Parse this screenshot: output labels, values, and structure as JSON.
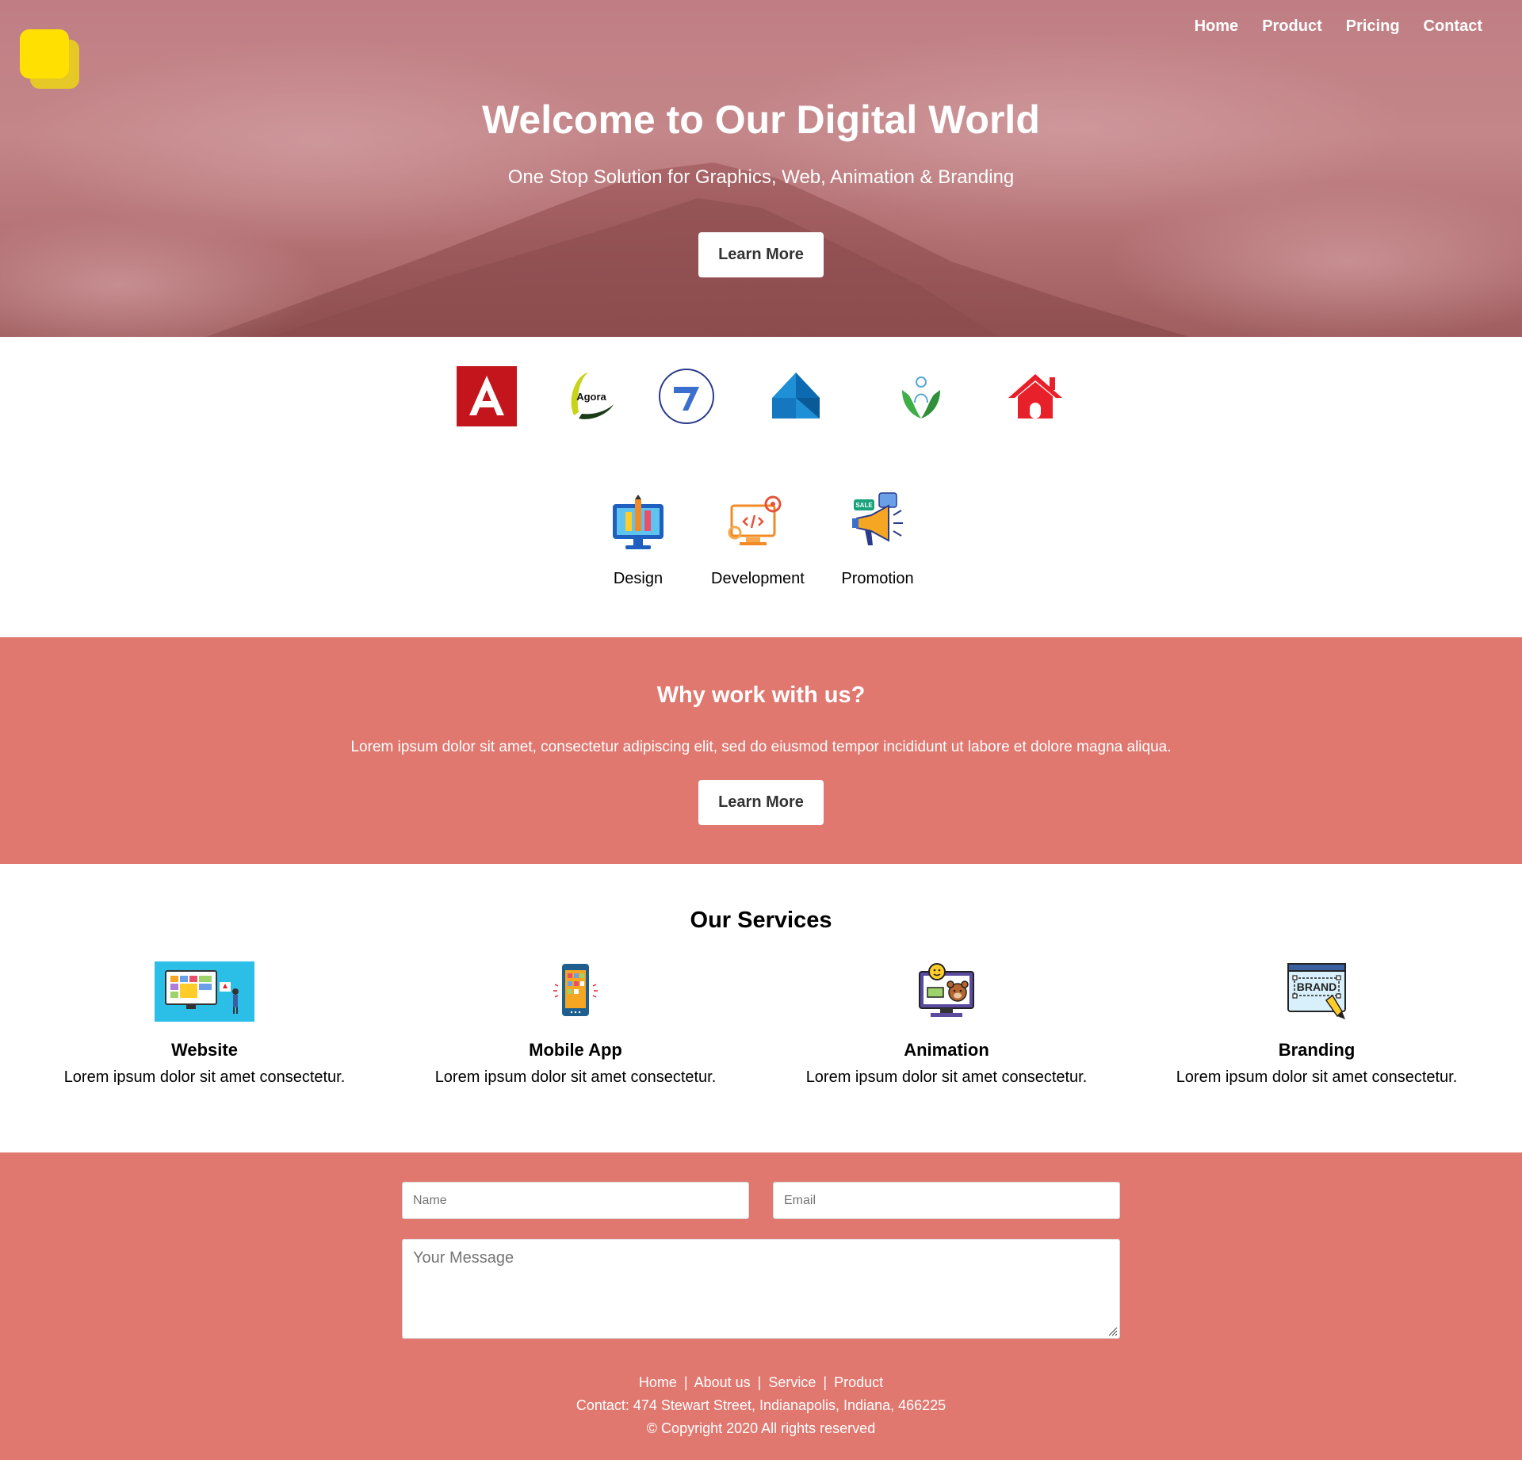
{
  "nav": {
    "items": [
      "Home",
      "Product",
      "Pricing",
      "Contact"
    ]
  },
  "hero": {
    "title": "Welcome to Our Digital World",
    "subtitle": "One Stop Solution for Graphics, Web, Animation & Branding",
    "button": "Learn More"
  },
  "clients": {
    "agora_text": "Agora",
    "logos": [
      "angular-logo",
      "agora-logo",
      "stroke-logo",
      "blue-house-logo",
      "hands-person-logo",
      "red-house-logo"
    ]
  },
  "features": [
    {
      "label": "Design",
      "icon": "design-monitor-icon"
    },
    {
      "label": "Development",
      "icon": "development-monitor-icon"
    },
    {
      "label": "Promotion",
      "icon": "megaphone-icon"
    }
  ],
  "why": {
    "title": "Why work with us?",
    "text": "Lorem ipsum dolor sit amet, consectetur adipiscing elit, sed do eiusmod tempor incididunt ut labore et dolore magna aliqua.",
    "button": "Learn More"
  },
  "services": {
    "title": "Our Services",
    "items": [
      {
        "title": "Website",
        "text": "Lorem ipsum dolor sit amet consectetur.",
        "icon": "website-icon"
      },
      {
        "title": "Mobile App",
        "text": "Lorem ipsum dolor sit amet consectetur.",
        "icon": "mobile-app-icon"
      },
      {
        "title": "Animation",
        "text": "Lorem ipsum dolor sit amet consectetur.",
        "icon": "animation-icon"
      },
      {
        "title": "Branding",
        "text": "Lorem ipsum dolor sit amet consectetur.",
        "icon": "branding-icon"
      }
    ]
  },
  "contact_form": {
    "name_placeholder": "Name",
    "email_placeholder": "Email",
    "message_placeholder": "Your Message"
  },
  "footer": {
    "links": [
      "Home",
      "About us",
      "Service",
      "Product"
    ],
    "separator": "|",
    "contact": "Contact: 474 Stewart Street, Indianapolis, Indiana, 466225",
    "copyright": "© Copyright 2020 All rights reserved",
    "brand_text": "BRAND",
    "sale_text": "SALE"
  },
  "colors": {
    "accent": "#e07870",
    "logo_yellow": "#ffe000",
    "hero_tint": "#c07e84"
  }
}
